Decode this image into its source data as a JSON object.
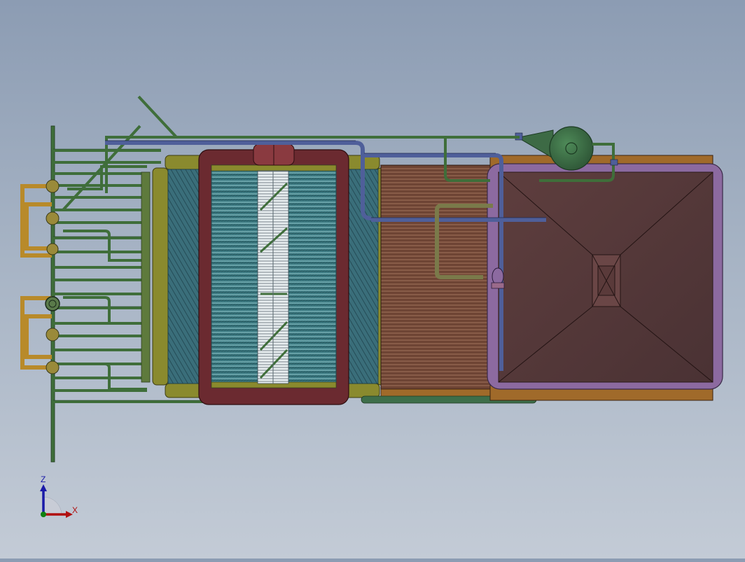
{
  "view": {
    "background_top": "#8c9cb3",
    "background_bottom": "#c3cbd6"
  },
  "triad": {
    "z_label": "Z",
    "x_label": "X",
    "z_color": "#1a1aa8",
    "x_color": "#b01010",
    "y_color": "#108010"
  },
  "model": {
    "pipe_green": "#3f6e3a",
    "pipe_blue": "#4f5f9a",
    "manifold_yellow": "#8a8a2e",
    "header_orange": "#b88a2a",
    "frame_red": "#6b2a30",
    "tube_teal": "#3f7c86",
    "tube_brown": "#6a4536",
    "hopper_brown": "#5a3c3c",
    "hopper_frame": "#8c6aa0",
    "fan_green": "#3d6a45"
  }
}
